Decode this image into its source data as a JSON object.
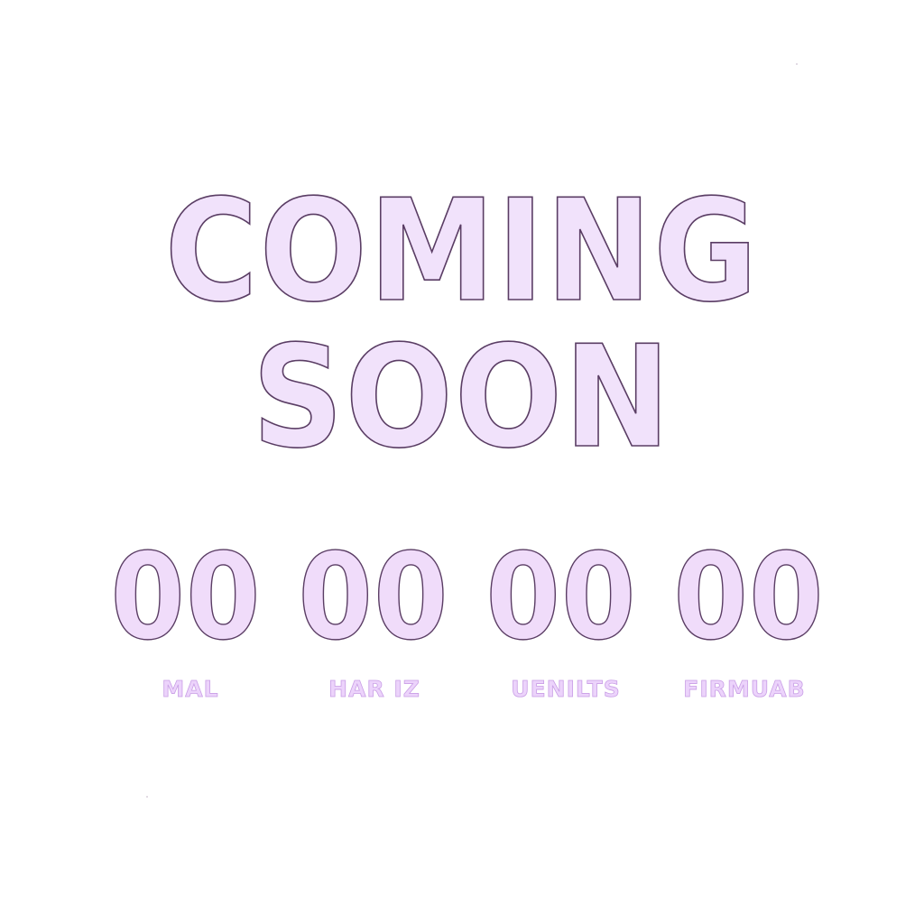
{
  "headline": {
    "line1": "COMING",
    "line2": "SOON"
  },
  "countdown": {
    "units": [
      {
        "value": "00",
        "label": "MAL"
      },
      {
        "value": "00",
        "label": "HAR IZ"
      },
      {
        "value": "00",
        "label": "UENILTS"
      },
      {
        "value": "00",
        "label": "FIRMUAB"
      }
    ]
  },
  "colors": {
    "background": "#ffffff",
    "text_fill": "#f1e2fb",
    "text_outline": "#5a3d64",
    "label_fill": "#ecd3fb"
  }
}
